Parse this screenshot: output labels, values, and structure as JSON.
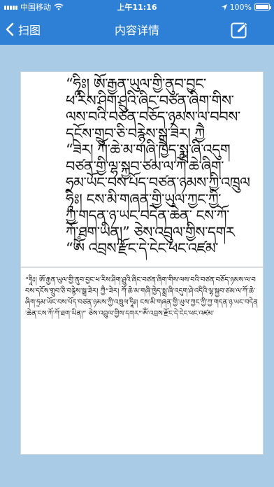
{
  "status_bar": {
    "carrier": "中国移动",
    "time": "上午11:16",
    "battery": "100%",
    "battery_level": 1.0
  },
  "nav": {
    "back_label": "扫图",
    "title": "内容详情",
    "edit_icon": "edit-icon"
  },
  "scan_lines": [
    "“ཧཱིཿ། ཨོ་རྒྱན་ཡུལ་གྱི་ནུབ་བྱང་",
    "ཕ་རིས་ཤིག་ཤྲུའི་ཞིང་བཙན་ཞིག་གིས་",
    "ལས་བའི་བཙན་བཅོད་ཉམས་ལ་བབས་",
    "དངོས་གྲུབ་ཅི་བརྙེས་སྒྲ་ཟེར། ཀྱཻ",
    "“ཟེར། ཀོ་ཆེ་མ་གཞི་ཁྱེད་སྨྲ་ཞི་འདུག",
    "བཙན་གྱི་ལྷ་སྐྱབ་ཙམ་ལ་ཀོ་ཆེ་ཞིག་",
    "ཧྲམ་ཡོང་བས་པོད་བཙན་ཉམས་ཀྱི་འཁྲུལ",
    "ཧཱིཿ། ངས་མི་གཞན་གྱི་ཡུལ་ཀྱང་ཀྱི་",
    "ཀྱ་གདན་ཉ་ཡང་བདེན་ཆེན་ ངས་ཀོ་",
    "ཀོ་ཐག་ཡིན།” ཅེས་འབྲུལ་གྱིས་དགར",
    "“ཨོཾ  འབྲས་རྫོང་དེ་ངེང་ཕང་འཛམ་"
  ],
  "result_text": "“ཧཱིཿ། ཨོ་རྒྱན་ཡུལ་གྱི་ནུབ་བྱང་ཕ་རིས་ཤིག་ཤྲུའི་ཞིང་བཙན་ཞིག་གིས་ལས་བའི་བཙན་བཅོད་ཉམས་ལ་བབས་དངོས་གྲུབ་ཅི་བརྙེས་སྒྲ་ཟེར། ཀྱཻ“ཟེར། ཀོ་ཆེ་མ་གཞི་ཁྱེད་སྨྲ་ཞི་འདུག་ཤེ་འདིའི་ལྷ་སྐྱབ་ཙམ་ལ་ཀོ་ཆེ་ཞིག་ཧྲམ་ཡོང་བས་པོད་བཙན་ཉམས་ཀྱི་འཁྲུལ་ཧཱིཿ། ངས་མི་གཞན་གྱི་ཡུལ་ཀྱང་ཀྱི་ཀྱ་གདན་ཉ་ཡང་བདེན་ཆེན་ངས་ཀོ་ཀོ་ཐག་ཡིན།” ཅེས་འབྲུལ་གྱིས་དགར“ཨོཾ་འབྲས་རྫོང་དེ་ངེང་ཕང་འཛམ་"
}
